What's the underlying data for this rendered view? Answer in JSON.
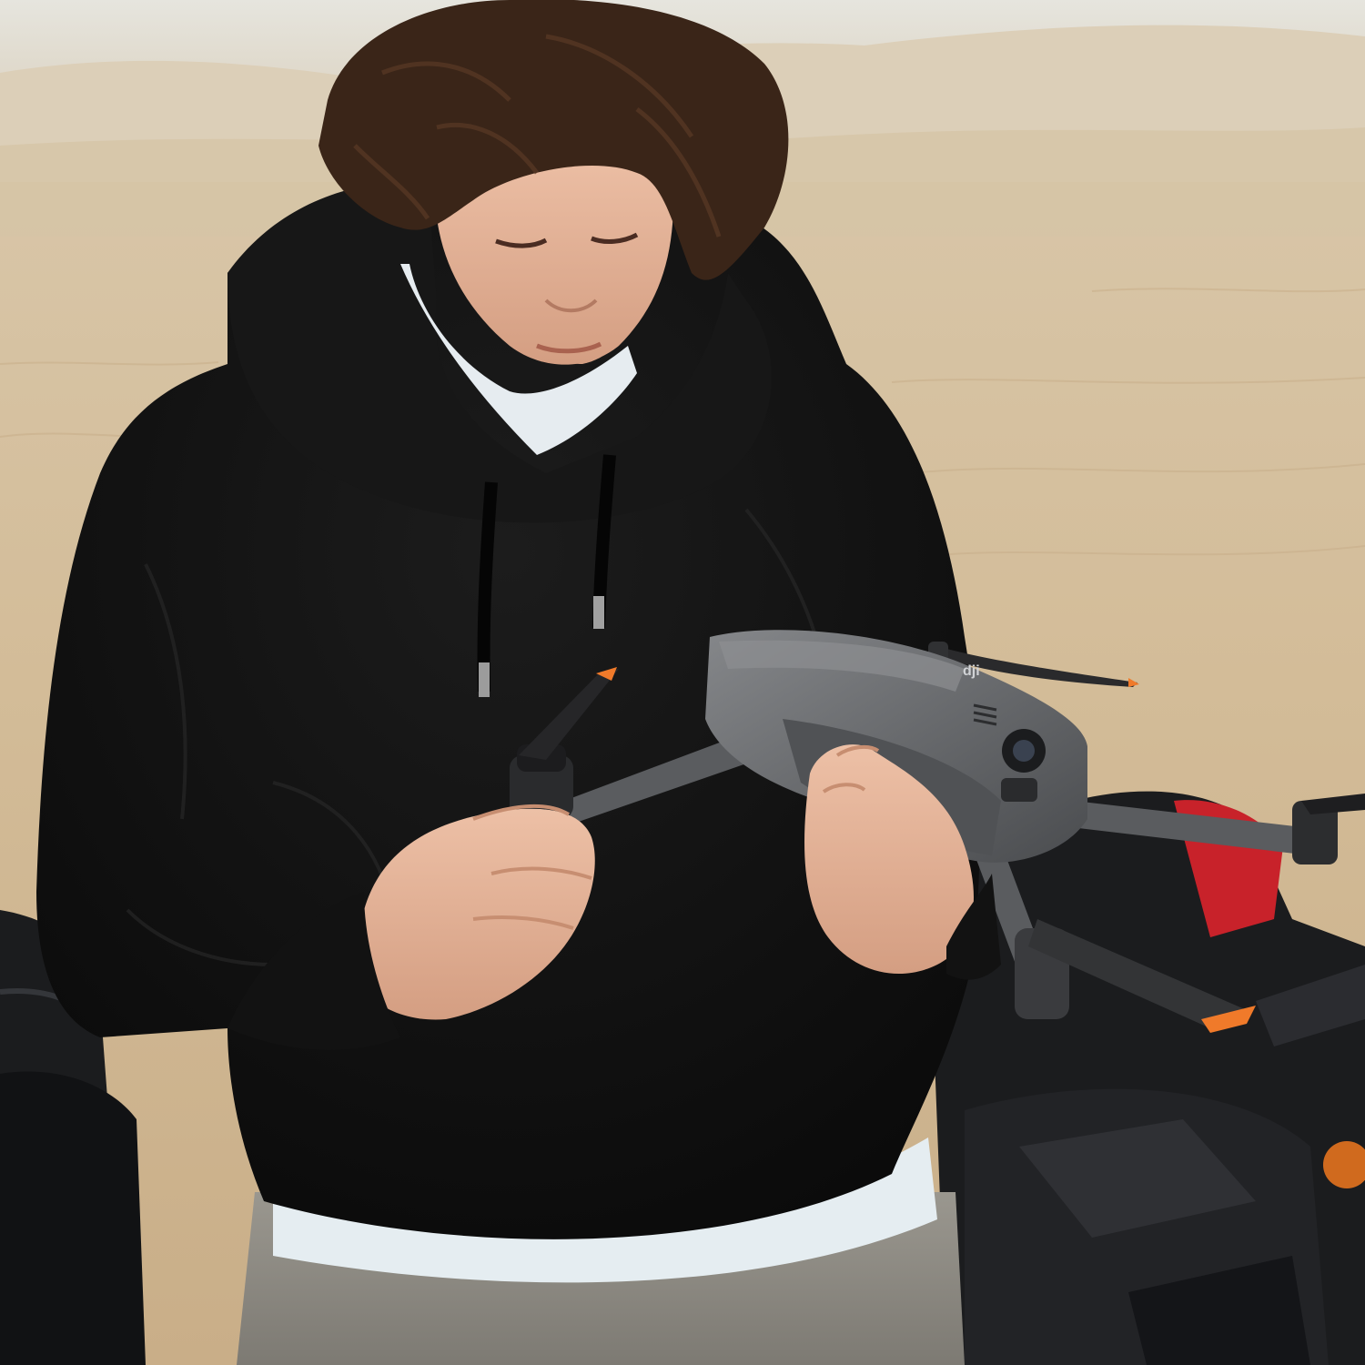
{
  "scene": {
    "description_text": "",
    "colors": {
      "sky": "#e4e2d8",
      "dune_far": "#d9ccb6",
      "sand": "#d4bd9a",
      "sand_dark": "#c8ae8a",
      "hoodie": "#141414",
      "hoodie_shadow": "#0a0a0a",
      "tshirt": "#e8eef2",
      "skin": "#e3b196",
      "hair": "#3a2518",
      "drone_body": "#5c5e61",
      "drone_light": "#7a7c7f",
      "propeller": "#2a2a2c",
      "prop_tip": "#f07a2a",
      "motorbike": "#1b1c1e",
      "bike_red": "#c8222a",
      "pants": "#8d8a84"
    },
    "objects": [
      "person",
      "drone",
      "motorcycle",
      "desert"
    ]
  },
  "drone": {
    "brand_mark": "dji"
  }
}
